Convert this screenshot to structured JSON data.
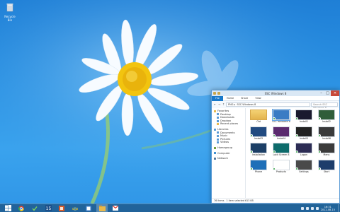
{
  "desktop": {
    "recycle_bin_label": "Recycle Bin"
  },
  "taskbar": {
    "start_icon": "windows-start-icon",
    "apps": [
      {
        "name": "chrome",
        "icon": "chrome-icon"
      },
      {
        "name": "app-check",
        "icon": "check-icon"
      },
      {
        "name": "calendar",
        "icon": "calendar-15-icon",
        "text": "15"
      },
      {
        "name": "media",
        "icon": "media-icon"
      },
      {
        "name": "ie",
        "icon": "internet-explorer-icon"
      },
      {
        "name": "photos",
        "icon": "photos-icon"
      },
      {
        "name": "explorer",
        "icon": "file-explorer-icon"
      },
      {
        "name": "gmail",
        "icon": "gmail-icon"
      }
    ],
    "clock_time": "16:31",
    "clock_date": "2012-08-15"
  },
  "explorer": {
    "title": "SSC Windows 8",
    "tabs": [
      "File",
      "Home",
      "Share",
      "View"
    ],
    "address": [
      "PNG ▸",
      "SSC Windows 8"
    ],
    "search_placeholder": "Search SSC Windows 8",
    "nav": {
      "favorites": {
        "label": "Favorites",
        "items": [
          "Desktop",
          "Downloads",
          "Dropbox",
          "Recent places"
        ]
      },
      "libraries": {
        "label": "Libraries",
        "items": [
          "Documents",
          "Music",
          "Pictures",
          "Videos"
        ]
      },
      "homegroup": "Homegroup",
      "computer": "Computer",
      "network": "Network"
    },
    "files": [
      {
        "name": "Old",
        "type": "folder"
      },
      {
        "name": "SSC Windows 8",
        "type": "image",
        "selected": true
      },
      {
        "name": "Install1",
        "type": "image"
      },
      {
        "name": "Install2",
        "type": "image"
      },
      {
        "name": "Install3",
        "type": "image"
      },
      {
        "name": "Install4",
        "type": "image"
      },
      {
        "name": "Install5",
        "type": "image"
      },
      {
        "name": "Install6",
        "type": "image"
      },
      {
        "name": "Installation",
        "type": "image"
      },
      {
        "name": "Lock Screen 8",
        "type": "image"
      },
      {
        "name": "Logon",
        "type": "image"
      },
      {
        "name": "Menu",
        "type": "image"
      },
      {
        "name": "Phone",
        "type": "image"
      },
      {
        "name": "Products",
        "type": "image"
      },
      {
        "name": "Settings",
        "type": "image"
      },
      {
        "name": "Start",
        "type": "image"
      }
    ],
    "status": {
      "count": "76 items",
      "selected": "1 item selected 613 KB"
    }
  }
}
